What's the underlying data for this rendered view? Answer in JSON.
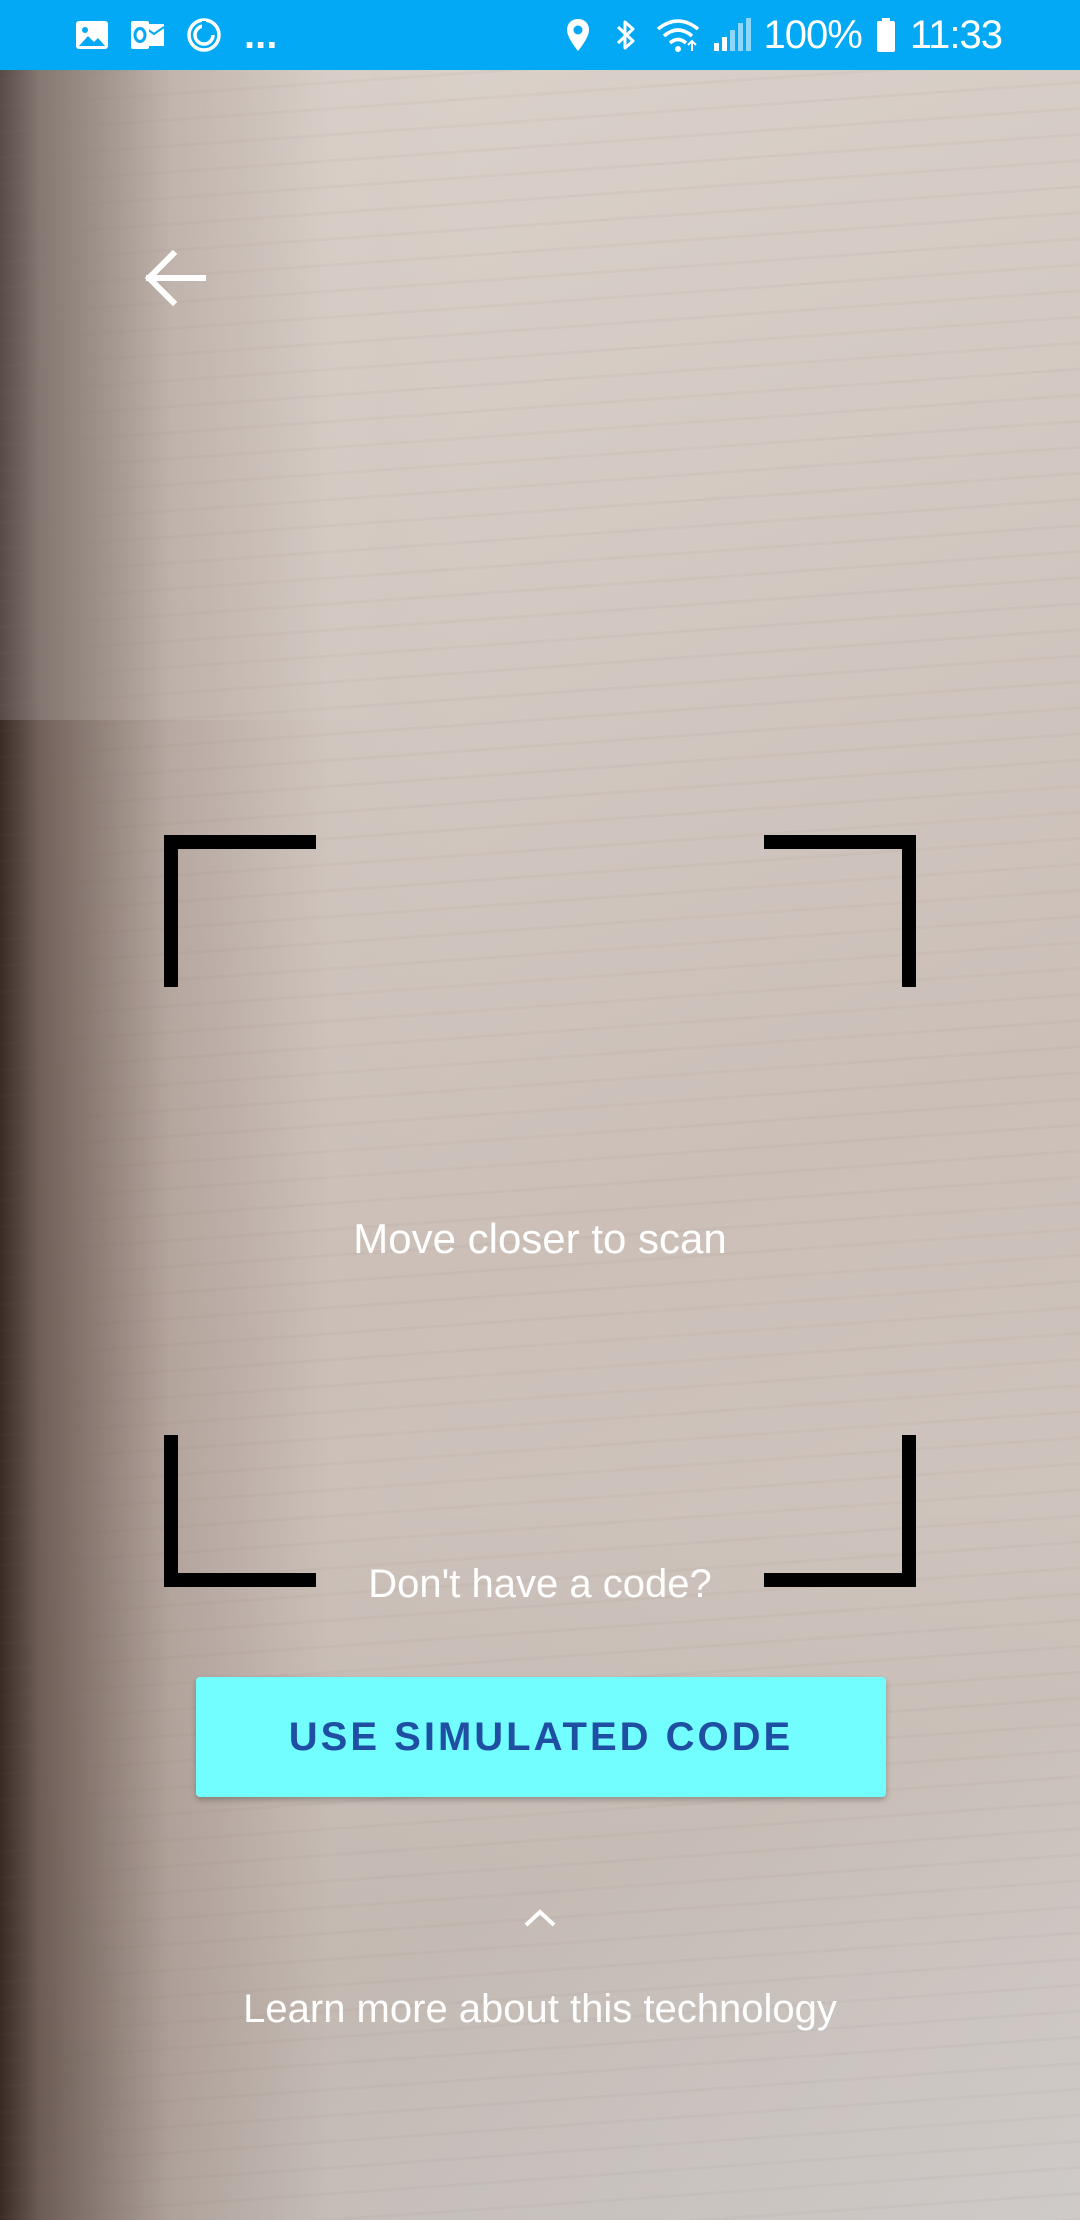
{
  "status_bar": {
    "notification_icons": [
      "gallery-icon",
      "outlook-icon",
      "sync-icon"
    ],
    "overflow": "...",
    "system_icons": [
      "location-icon",
      "bluetooth-icon",
      "wifi-icon",
      "signal-icon"
    ],
    "battery_percent": "100%",
    "time": "11:33",
    "color": "#03a9f4"
  },
  "toolbar": {
    "back_icon": "arrow-back-icon"
  },
  "scanner": {
    "hint": "Move closer to scan",
    "frame_color": "#000000"
  },
  "actions": {
    "no_code_prompt": "Don't have a code?",
    "simulate_label": "USE SIMULATED CODE",
    "simulate_bg": "#72fefe",
    "simulate_text_color": "#1f4fa3",
    "expand_icon": "chevron-up-icon",
    "learn_more_label": "Learn more about this technology"
  }
}
